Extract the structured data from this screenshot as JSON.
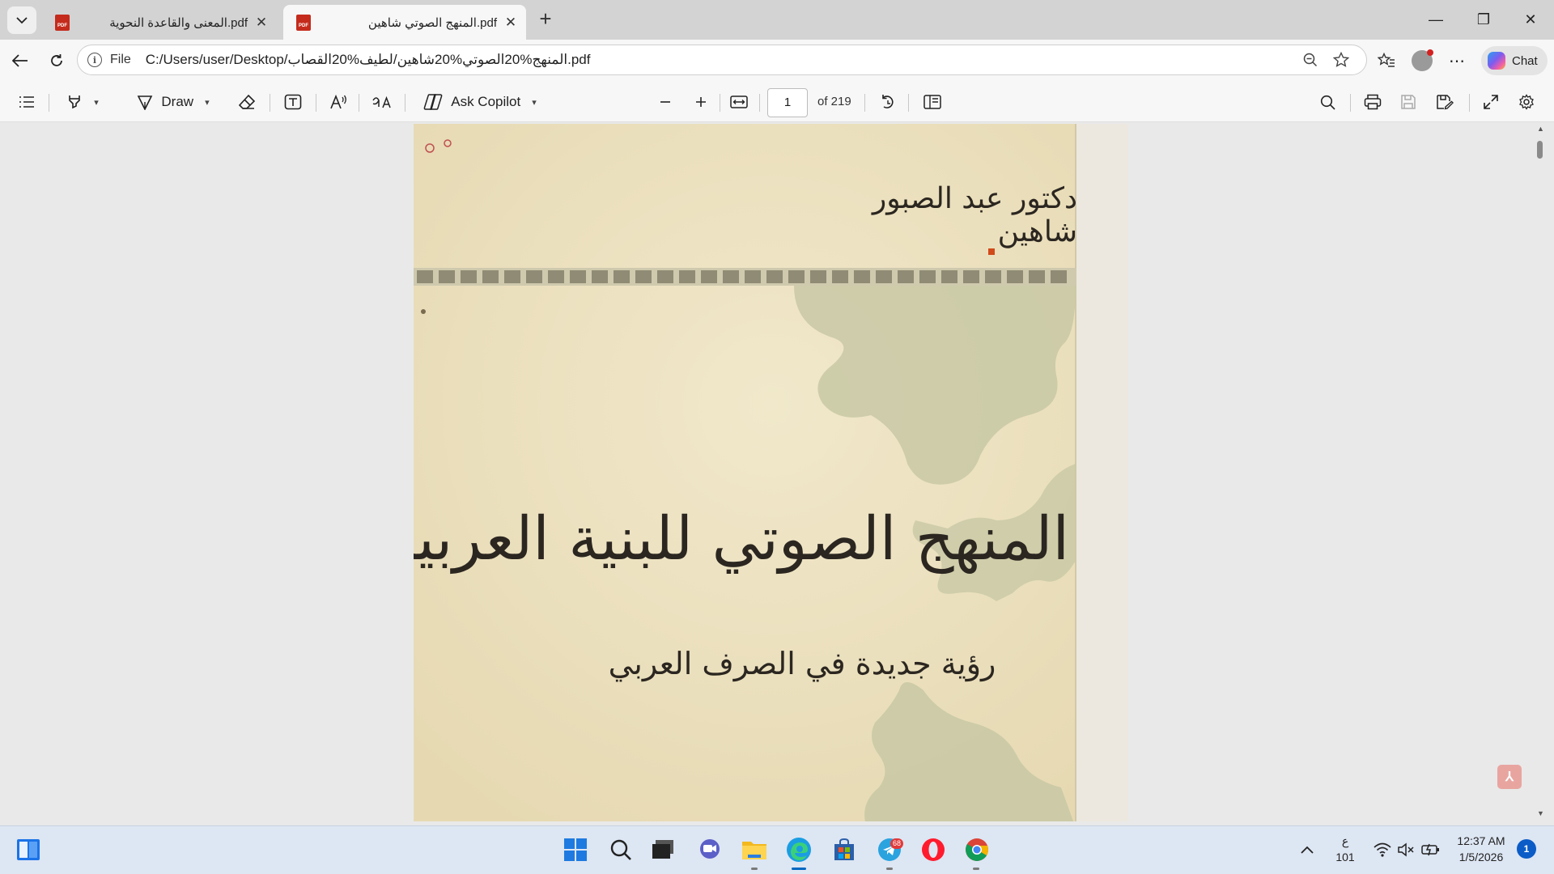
{
  "browser": {
    "tabs": [
      {
        "title": "المعنى والقاعدة النحوية.pdf",
        "icon": "pdf-icon",
        "active": false
      },
      {
        "title": "المنهج الصوتي شاهين.pdf",
        "icon": "pdf-icon",
        "active": true
      }
    ],
    "pdf_icon_text": "PDF",
    "new_tab_symbol": "+",
    "close_symbol": "✕",
    "window_controls": {
      "minimize": "—",
      "restore": "❐",
      "close": "✕"
    }
  },
  "address_bar": {
    "scheme_label": "File",
    "url": "C:/Users/user/Desktop/المنهج%20الصوتي%20شاهين/لطيف%20القصاب.pdf",
    "more_symbol": "⋯",
    "chat_label": "Chat"
  },
  "pdf_toolbar": {
    "draw_label": "Draw",
    "copilot_label": "Ask Copilot",
    "page_current": "1",
    "page_total": "of 219"
  },
  "document": {
    "author": "دكتور عبد الصبور شاهين",
    "title": "المنهج الصوتي للبنية العربية",
    "subtitle": "رؤية جديدة في الصرف العربي"
  },
  "taskbar": {
    "apps": [
      "start",
      "search",
      "task-view",
      "teams-meet",
      "file-explorer",
      "edge",
      "store",
      "telegram",
      "opera",
      "chrome"
    ],
    "telegram_badge": "68",
    "language_top": "ع",
    "language_bottom": "101",
    "time": "12:37 AM",
    "date": "1/5/2026",
    "notification_count": "1"
  },
  "colors": {
    "accent": "#0067c0",
    "page_paper": "#ede3c4",
    "page_ornament": "#c9c9a6",
    "pdf_red": "#c42b1c"
  }
}
